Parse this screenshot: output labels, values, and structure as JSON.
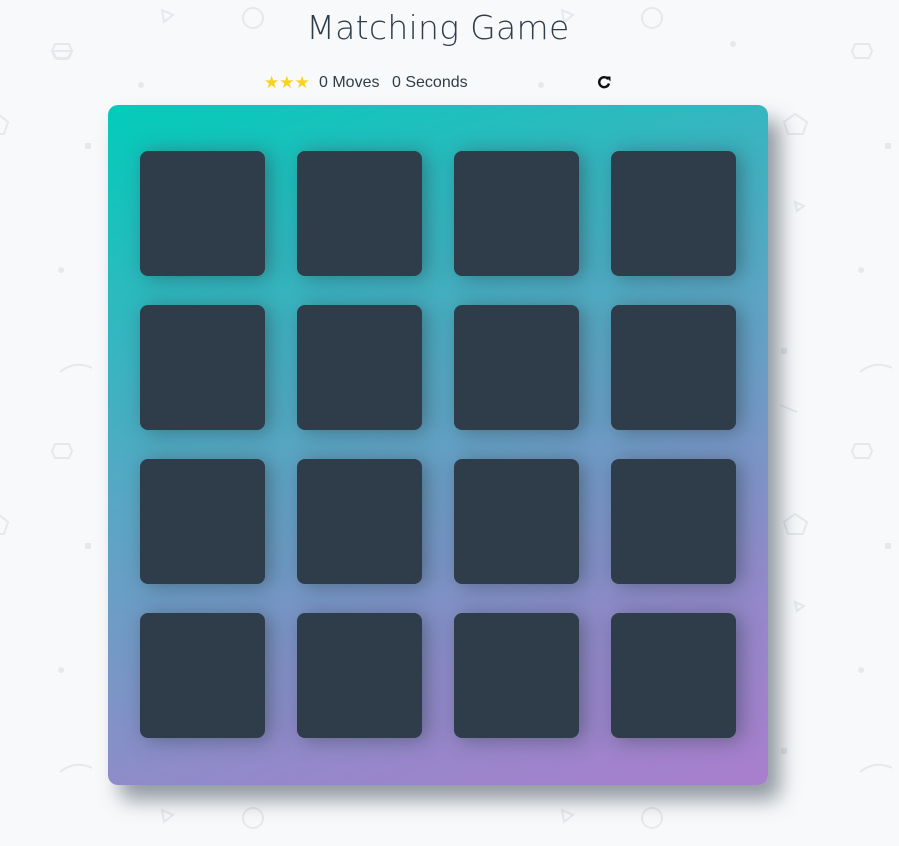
{
  "title": "Matching Game",
  "score_panel": {
    "stars": [
      "star",
      "star",
      "star"
    ],
    "star_rating": 3,
    "moves": "0",
    "moves_label": "Moves",
    "moves_text": "0 Moves",
    "seconds_text": "0 Seconds",
    "restart_icon": "restart-icon"
  },
  "deck": {
    "rows": 4,
    "cols": 4,
    "cards": [
      {
        "state": "face-down"
      },
      {
        "state": "face-down"
      },
      {
        "state": "face-down"
      },
      {
        "state": "face-down"
      },
      {
        "state": "face-down"
      },
      {
        "state": "face-down"
      },
      {
        "state": "face-down"
      },
      {
        "state": "face-down"
      },
      {
        "state": "face-down"
      },
      {
        "state": "face-down"
      },
      {
        "state": "face-down"
      },
      {
        "state": "face-down"
      },
      {
        "state": "face-down"
      },
      {
        "state": "face-down"
      },
      {
        "state": "face-down"
      },
      {
        "state": "face-down"
      }
    ]
  },
  "colors": {
    "card_back": "#2e3d49",
    "star": "#f8d21b",
    "deck_gradient_start": "#02ccba",
    "deck_gradient_end": "#aa7ecd",
    "background": "#f8f9fb"
  }
}
